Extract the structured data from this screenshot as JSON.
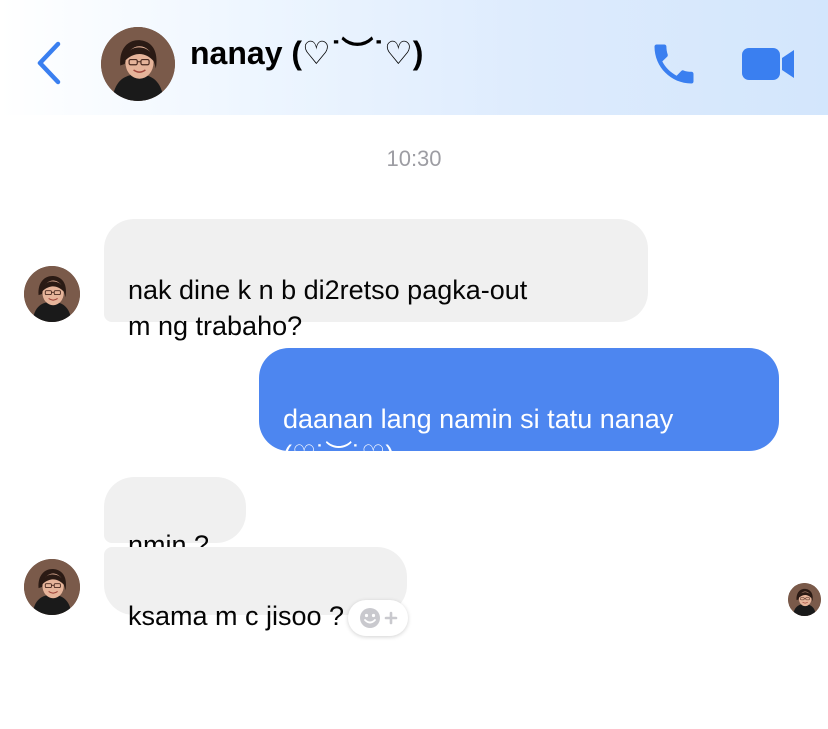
{
  "header": {
    "contact_name": "nanay (♡˙︶˙♡)",
    "icons": {
      "back": "chevron-left-icon",
      "call": "phone-icon",
      "video": "video-camera-icon"
    },
    "accent_color": "#3a7ff0"
  },
  "conversation": {
    "timestamp": "10:30",
    "messages": [
      {
        "sender": "contact",
        "text": "nak dine k n b di2retso pagka-out\nm ng trabaho?"
      },
      {
        "sender": "me",
        "text": "daanan lang namin si tatu nanay\n(♡˙︶˙♡)"
      },
      {
        "sender": "contact",
        "text": "nmin ?"
      },
      {
        "sender": "contact",
        "text": "ksama m c jisoo ?"
      }
    ],
    "reaction_icon": "smiley-plus-icon"
  },
  "colors": {
    "incoming_bubble": "#f0f0f0",
    "outgoing_bubble": "#4d86f0",
    "timestamp_text": "#9d9da3"
  }
}
